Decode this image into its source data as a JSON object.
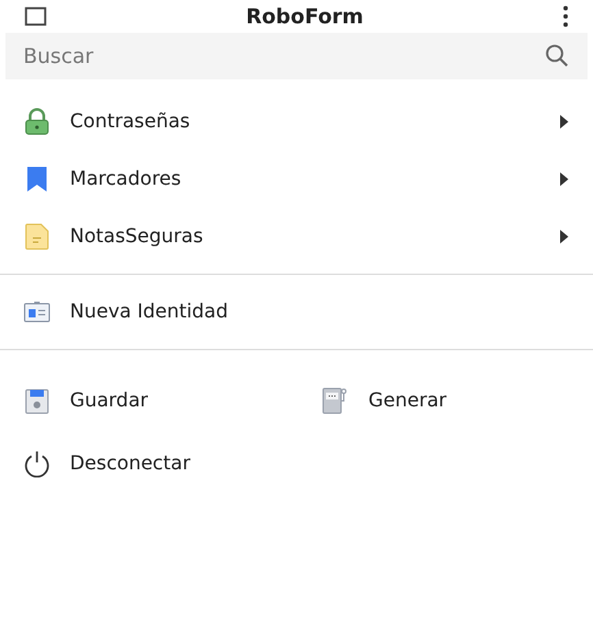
{
  "header": {
    "title": "RoboForm"
  },
  "search": {
    "placeholder": "Buscar"
  },
  "sections": [
    {
      "items": [
        {
          "label": "Contraseñas",
          "kind": "lock",
          "submenu": true
        },
        {
          "label": "Marcadores",
          "kind": "bookmark",
          "submenu": true
        },
        {
          "label": "NotasSeguras",
          "kind": "note",
          "submenu": true
        }
      ]
    },
    {
      "items": [
        {
          "label": "Nueva Identidad",
          "kind": "identity",
          "submenu": false
        }
      ]
    }
  ],
  "actions": [
    {
      "label": "Guardar",
      "kind": "save"
    },
    {
      "label": "Generar",
      "kind": "generator"
    },
    {
      "label": "Desconectar",
      "kind": "power"
    }
  ]
}
